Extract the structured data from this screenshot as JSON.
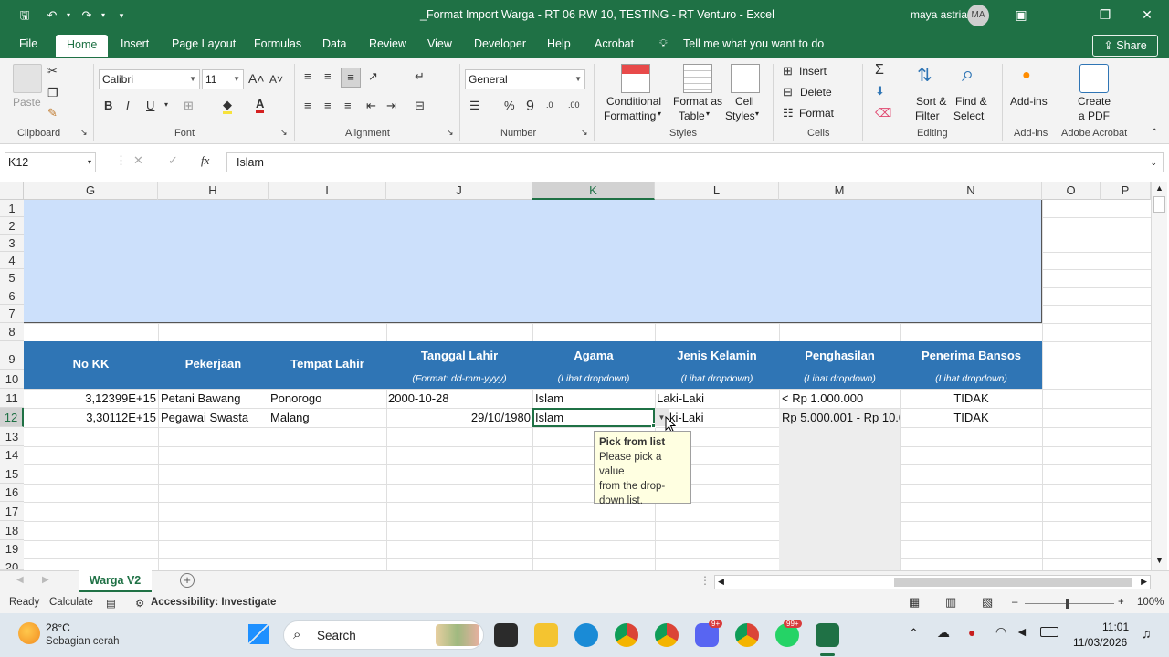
{
  "window": {
    "title": "_Format Import Warga - RT 06 RW 10, TESTING - RT Venturo  -  Excel",
    "user_name": "maya astria",
    "user_initials": "MA"
  },
  "tabs": [
    "File",
    "Home",
    "Insert",
    "Page Layout",
    "Formulas",
    "Data",
    "Review",
    "View",
    "Developer",
    "Help",
    "Acrobat"
  ],
  "active_tab": "Home",
  "tell_me": "Tell me what you want to do",
  "share_label": "Share",
  "ribbon": {
    "clipboard": {
      "label": "Clipboard",
      "paste": "Paste"
    },
    "font": {
      "label": "Font",
      "name": "Calibri",
      "size": "11"
    },
    "alignment": {
      "label": "Alignment"
    },
    "number": {
      "label": "Number",
      "format": "General"
    },
    "styles": {
      "label": "Styles",
      "conditional_1": "Conditional",
      "conditional_2": "Formatting",
      "format_as_1": "Format as",
      "format_as_2": "Table",
      "cell_styles_1": "Cell",
      "cell_styles_2": "Styles"
    },
    "cells": {
      "label": "Cells",
      "insert": "Insert",
      "delete": "Delete",
      "format": "Format"
    },
    "editing": {
      "label": "Editing",
      "sort_1": "Sort &",
      "sort_2": "Filter",
      "find_1": "Find &",
      "find_2": "Select"
    },
    "addins": {
      "label": "Add-ins",
      "button": "Add-ins"
    },
    "acrobat": {
      "label": "Adobe Acrobat",
      "create_1": "Create",
      "create_2": "a PDF"
    }
  },
  "formula_bar": {
    "name_box": "K12",
    "fx": "fx",
    "value": "Islam"
  },
  "columns": [
    "G",
    "H",
    "I",
    "J",
    "K",
    "L",
    "M",
    "N",
    "O",
    "P"
  ],
  "selected_column": "K",
  "rows": [
    "1",
    "2",
    "3",
    "4",
    "5",
    "6",
    "7",
    "8",
    "9",
    "10",
    "11",
    "12",
    "13",
    "14",
    "15",
    "16",
    "17",
    "18",
    "19",
    "20"
  ],
  "selected_row": "12",
  "table_headers": [
    {
      "title": "No KK",
      "sub": ""
    },
    {
      "title": "Pekerjaan",
      "sub": ""
    },
    {
      "title": "Tempat Lahir",
      "sub": ""
    },
    {
      "title": "Tanggal Lahir",
      "sub": "(Format: dd-mm-yyyy)"
    },
    {
      "title": "Agama",
      "sub": "(Lihat dropdown)"
    },
    {
      "title": "Jenis Kelamin",
      "sub": "(Lihat dropdown)"
    },
    {
      "title": "Penghasilan",
      "sub": "(Lihat dropdown)"
    },
    {
      "title": "Penerima Bansos",
      "sub": "(Lihat dropdown)"
    }
  ],
  "table_rows": [
    {
      "no_kk": "3,12399E+15",
      "pekerjaan": "Petani Bawang",
      "tempat": "Ponorogo",
      "tanggal": "2000-10-28",
      "agama": "Islam",
      "jk": "Laki-Laki",
      "penghasilan": "< Rp 1.000.000",
      "bansos": "TIDAK"
    },
    {
      "no_kk": "3,30112E+15",
      "pekerjaan": "Pegawai Swasta",
      "tempat": "Malang",
      "tanggal": "29/10/1980",
      "agama": "Islam",
      "jk": "ki-Laki",
      "penghasilan": "Rp 5.000.001 - Rp 10.0",
      "bansos": "TIDAK"
    }
  ],
  "tooltip": {
    "title": "Pick from list",
    "line1": "Please pick a value",
    "line2": "from the drop-",
    "line3": "down list."
  },
  "sheet_tab": "Warga V2",
  "status": {
    "ready": "Ready",
    "calculate": "Calculate",
    "accessibility": "Accessibility: Investigate",
    "zoom": "100%"
  },
  "taskbar": {
    "temp": "28°C",
    "weather": "Sebagian cerah",
    "search": "Search",
    "time": "11:01",
    "date": "11/03/2026",
    "badge_discord": "9+",
    "badge_whatsapp": "99+"
  },
  "colors": {
    "excel_green": "#1f7145",
    "header_blue": "#2f75b5",
    "light_blue": "#cce0fb"
  }
}
